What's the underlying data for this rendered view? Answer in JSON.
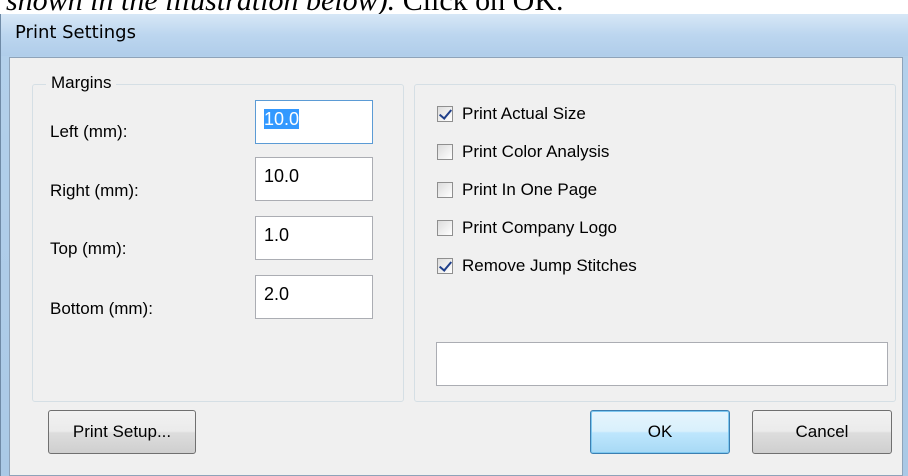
{
  "caption": {
    "lead": "shown in the illustration below). ",
    "tail": "Click on OK."
  },
  "dialog": {
    "title": "Print Settings"
  },
  "margins": {
    "group_label": "Margins",
    "fields": [
      {
        "label": "Left (mm):",
        "value": "10.0"
      },
      {
        "label": "Right (mm):",
        "value": "10.0"
      },
      {
        "label": "Top (mm):",
        "value": "1.0"
      },
      {
        "label": "Bottom (mm):",
        "value": "2.0"
      }
    ]
  },
  "options": [
    {
      "label": "Print Actual Size",
      "checked": true
    },
    {
      "label": "Print Color Analysis",
      "checked": false
    },
    {
      "label": "Print In One Page",
      "checked": false
    },
    {
      "label": "Print Company Logo",
      "checked": false
    },
    {
      "label": "Remove Jump Stitches",
      "checked": true
    }
  ],
  "status_text": "",
  "buttons": {
    "print_setup": "Print Setup...",
    "ok": "OK",
    "cancel": "Cancel"
  }
}
